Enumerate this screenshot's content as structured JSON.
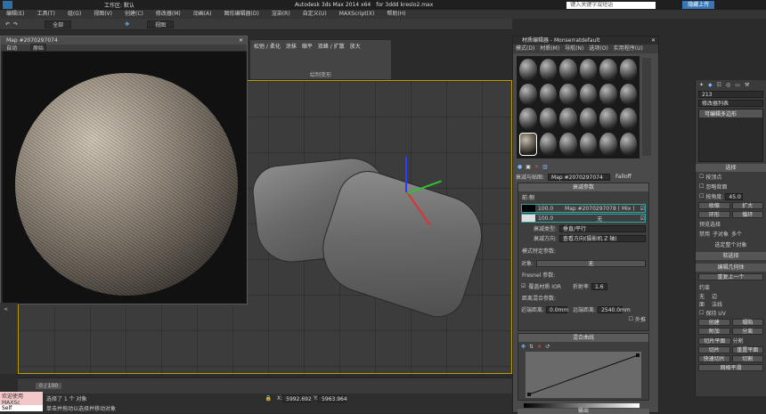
{
  "app": {
    "title": "Autodesk 3ds Max  2014 x64",
    "file": "for 3ddd kreslo2.max",
    "workspace": "工作区: 默认",
    "search_placeholder": "键入关键字或短语",
    "login": "隐藏上传"
  },
  "menubar": [
    "编辑(E)",
    "工具(T)",
    "组(G)",
    "视图(V)",
    "创建(C)",
    "修改器(M)",
    "动画(A)",
    "图形编辑器(D)",
    "渲染(R)",
    "自定义(U)",
    "MAXScript(X)",
    "帮助(H)"
  ],
  "toolbar": {
    "selection_filter": "全部",
    "view": "视图"
  },
  "ribbon": {
    "items": [
      "松弛 / 柔化",
      "涂抹",
      "头",
      "缩平",
      "双峰 / 扩散",
      "放大"
    ],
    "group_label": "绘制变形"
  },
  "map_window": {
    "title": "Map #2070297074",
    "mode": "自动",
    "channel": "原始"
  },
  "material_editor": {
    "title": "材质编辑器 - Monserratdefault",
    "menu": [
      "模式(D)",
      "材质(M)",
      "导航(N)",
      "选项(O)",
      "实用程序(U)"
    ],
    "map_label": "衰减与贴图:",
    "map_name": "Map #2070297074",
    "map_type": "Falloff",
    "rollout_falloff_params": "衰减参数",
    "front_side": "前:侧",
    "row1_value": "100.0",
    "row1_map": "Map #2070297078  ( Mix )",
    "row2_value": "100.0",
    "row2_map": "无",
    "falloff_type_label": "衰减类型:",
    "falloff_type": "垂直/平行",
    "falloff_dir_label": "衰减方向:",
    "falloff_dir": "查看方向(摄影机 Z 轴)",
    "mode_params": "模式特定参数:",
    "object_label": "对象:",
    "object_value": "无",
    "fresnel": "Fresnel 参数:",
    "override_label": "覆盖材质 IOR",
    "ior_label": "折射率",
    "ior_value": "1.6",
    "distance_label": "距离混合参数:",
    "near_label": "近端距离:",
    "near_value": "0.0mm",
    "far_label": "远端距离:",
    "far_value": "2540.0mm",
    "extrapolate": "外推",
    "mix_curve": "混合曲线",
    "output": "输出"
  },
  "command_panel": {
    "object_name": "213",
    "modifier_list": "修改器列表",
    "stack_item": "可编辑多边形",
    "selection": "选择",
    "by_vertex": "按顶点",
    "ignore_back": "忽略背面",
    "by_angle": "按角度:",
    "angle_value": "45.0",
    "shrink": "收缩",
    "grow": "扩大",
    "ring": "环形",
    "loop": "循环",
    "preview_sel": "预览选择",
    "disabled": "禁用",
    "subobj": "子对象",
    "multi": "多个",
    "selected_count": "选定整个对象",
    "soft_sel": "软选择",
    "edit_geometry": "编辑几何体",
    "repeat_last": "重复上一个",
    "constraints": "约束",
    "none": "无",
    "edge": "边",
    "face": "面",
    "normal": "法线",
    "preserve_uv": "保持 UV",
    "create": "创建",
    "collapse": "塌陷",
    "attach": "附加",
    "detach": "分离",
    "slice_plane": "切片平面",
    "split": "分割",
    "slice": "切片",
    "reset_plane": "重置平面",
    "quickslice": "快速切片",
    "cut": "切割",
    "mesh_smooth": "网格平滑"
  },
  "timeline": {
    "frame": "0 / 100"
  },
  "status": {
    "selected": "选择了 1 个 对象",
    "hint": "单击并拖动以选择并移动对象",
    "x_value": "5992.692",
    "y_value": "5963.964",
    "welcome": "欢迎使用 MAXSc",
    "self_label": "Self"
  }
}
